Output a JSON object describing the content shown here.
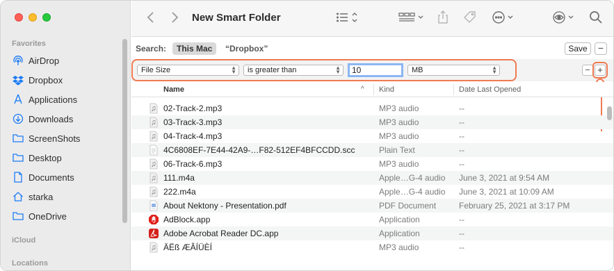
{
  "toolbar": {
    "title": "New Smart Folder"
  },
  "sidebar": {
    "favorites_title": "Favorites",
    "items": [
      {
        "label": "AirDrop"
      },
      {
        "label": "Dropbox"
      },
      {
        "label": "Applications"
      },
      {
        "label": "Downloads"
      },
      {
        "label": "ScreenShots"
      },
      {
        "label": "Desktop"
      },
      {
        "label": "Documents"
      },
      {
        "label": "starka"
      },
      {
        "label": "OneDrive"
      }
    ],
    "icloud_title": "iCloud",
    "locations_title": "Locations"
  },
  "search": {
    "label": "Search:",
    "scope_this_mac": "This Mac",
    "scope_dropbox": "“Dropbox”",
    "save_label": "Save",
    "minus_label": "−"
  },
  "criteria": {
    "attribute": "File Size",
    "operator": "is greater than",
    "value": "10",
    "unit": "MB",
    "minus_label": "−",
    "plus_label": "+"
  },
  "columns": {
    "name": "Name",
    "kind": "Kind",
    "date": "Date Last Opened"
  },
  "files": [
    {
      "name": "02-Track-2.mp3",
      "kind": "MP3 audio",
      "date": "--",
      "icon": "audio-file-icon"
    },
    {
      "name": "03-Track-3.mp3",
      "kind": "MP3 audio",
      "date": "--",
      "icon": "audio-file-icon"
    },
    {
      "name": "04-Track-4.mp3",
      "kind": "MP3 audio",
      "date": "--",
      "icon": "audio-file-icon"
    },
    {
      "name": "4C6808EF-7E44-42A9-…F82-512EF4BFCCDD.scc",
      "kind": "Plain Text",
      "date": "--",
      "icon": "text-file-icon"
    },
    {
      "name": "06-Track-6.mp3",
      "kind": "MP3 audio",
      "date": "--",
      "icon": "audio-file-icon"
    },
    {
      "name": "111.m4a",
      "kind": "Apple…G-4 audio",
      "date": "June 3, 2021 at 9:54 AM",
      "icon": "audio-file-icon"
    },
    {
      "name": "222.m4a",
      "kind": "Apple…G-4 audio",
      "date": "June 3, 2021 at 10:09 AM",
      "icon": "audio-file-icon"
    },
    {
      "name": "About Nektony - Presentation.pdf",
      "kind": "PDF Document",
      "date": "February 25, 2021 at 3:17 PM",
      "icon": "pdf-file-icon"
    },
    {
      "name": "AdBlock.app",
      "kind": "Application",
      "date": "--",
      "icon": "adblock-app-icon"
    },
    {
      "name": "Adobe Acrobat Reader DC.app",
      "kind": "Application",
      "date": "--",
      "icon": "acrobat-app-icon"
    },
    {
      "name": "ÄËß ÆÂÍÜÈÍ",
      "kind": "MP3 audio",
      "date": "--",
      "icon": "audio-file-icon"
    }
  ],
  "colors": {
    "accent": "#1b7cf5",
    "highlight": "#f07a52"
  }
}
